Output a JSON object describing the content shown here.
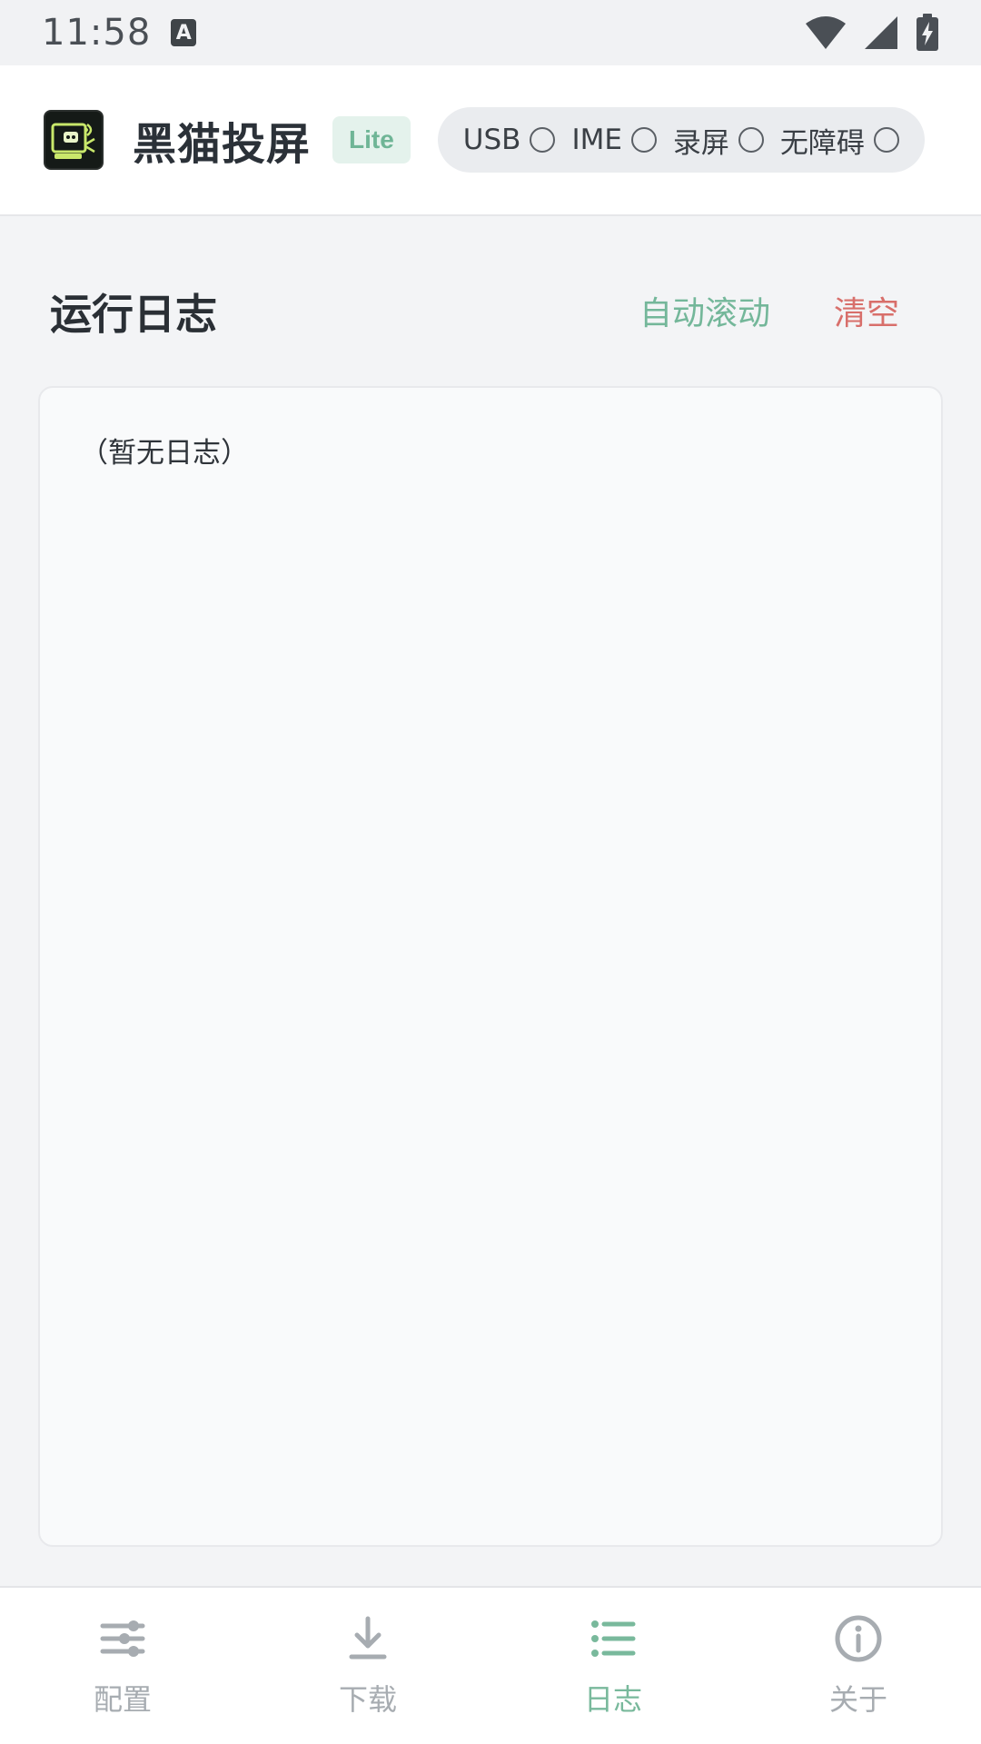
{
  "status_bar": {
    "time": "11:58",
    "ime_indicator": "A"
  },
  "header": {
    "app_name": "黑猫投屏",
    "badge": "Lite",
    "toggles": [
      {
        "label": "USB"
      },
      {
        "label": "IME"
      },
      {
        "label": "录屏"
      },
      {
        "label": "无障碍"
      }
    ]
  },
  "log_section": {
    "title": "运行日志",
    "auto_scroll_label": "自动滚动",
    "clear_label": "清空",
    "empty_text": "（暂无日志）"
  },
  "bottom_nav": {
    "items": [
      {
        "label": "配置",
        "icon": "sliders-icon"
      },
      {
        "label": "下载",
        "icon": "download-icon"
      },
      {
        "label": "日志",
        "icon": "list-icon"
      },
      {
        "label": "关于",
        "icon": "info-icon"
      }
    ],
    "active_index": 2
  },
  "colors": {
    "accent": "#79b99c",
    "danger": "#d86f6b"
  }
}
